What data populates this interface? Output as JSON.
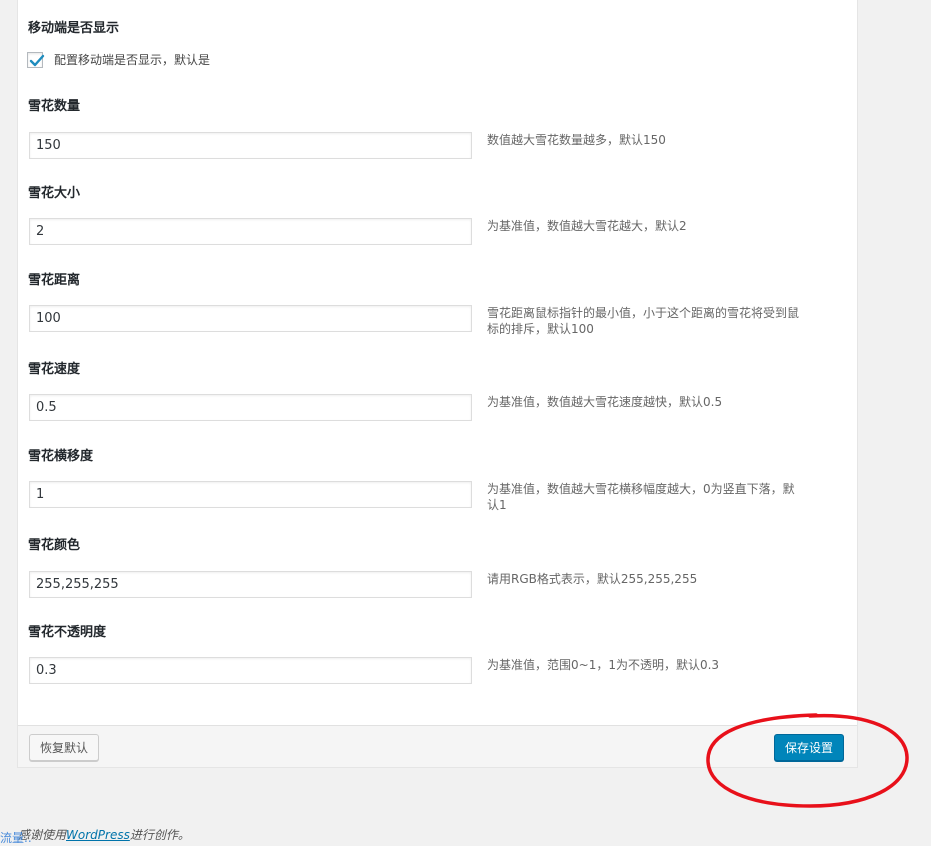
{
  "mobile": {
    "title": "移动端是否显示",
    "checkbox_label": "配置移动端是否显示，默认是",
    "checked": true
  },
  "fields": [
    {
      "label": "雪花数量",
      "value": "150",
      "hint": "数值越大雪花数量越多，默认150"
    },
    {
      "label": "雪花大小",
      "value": "2",
      "hint": "为基准值，数值越大雪花越大，默认2"
    },
    {
      "label": "雪花距离",
      "value": "100",
      "hint": "雪花距离鼠标指针的最小值，小于这个距离的雪花将受到鼠标的排斥，默认100"
    },
    {
      "label": "雪花速度",
      "value": "0.5",
      "hint": "为基准值，数值越大雪花速度越快，默认0.5"
    },
    {
      "label": "雪花横移度",
      "value": "1",
      "hint": "为基准值，数值越大雪花横移幅度越大，0为竖直下落，默认1"
    },
    {
      "label": "雪花颜色",
      "value": "255,255,255",
      "hint": "请用RGB格式表示，默认255,255,255"
    },
    {
      "label": "雪花不透明度",
      "value": "0.3",
      "hint": "为基准值，范围0~1，1为不透明，默认0.3"
    }
  ],
  "buttons": {
    "reset_label": "恢复默认",
    "save_label": "保存设置"
  },
  "footer": {
    "credit_prefix": "感谢使用",
    "credit_link": "WordPress",
    "credit_suffix": "进行创作。",
    "overlay_text": "流量.."
  },
  "colors": {
    "primary_button": "#0085ba",
    "annotation": "#e8101a",
    "checkmark": "#1e8cbe"
  }
}
